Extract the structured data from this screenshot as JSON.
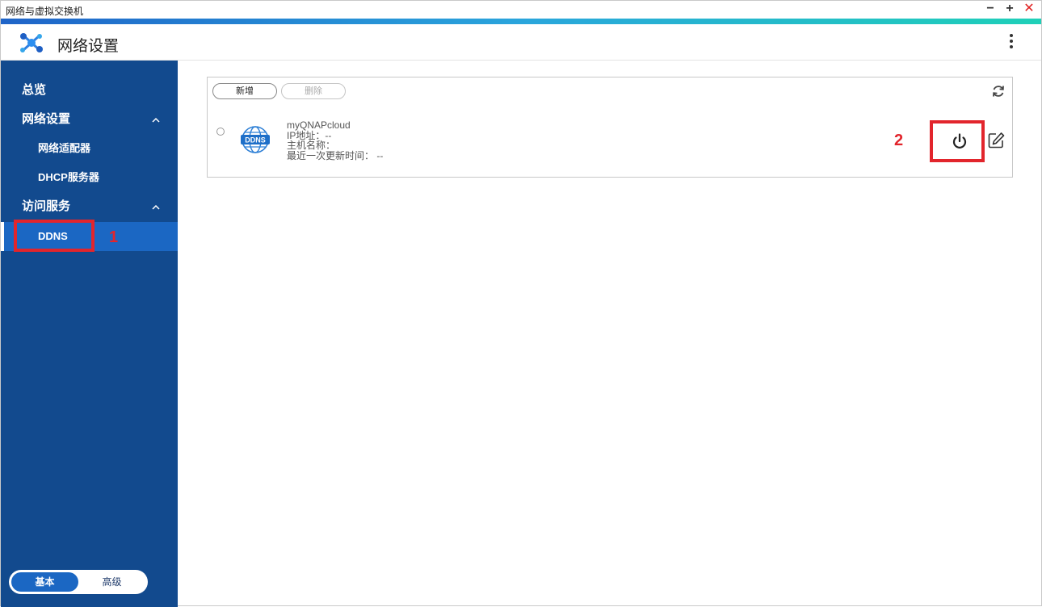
{
  "window": {
    "title": "网络与虚拟交换机",
    "controls": {
      "minimize": "−",
      "maximize": "+",
      "close": "✕"
    }
  },
  "header": {
    "app_title": "网络设置",
    "app_icon": "network-settings-icon",
    "menu_icon": "kebab-menu-icon"
  },
  "sidebar": {
    "overview": "总览",
    "network_settings": "网络设置",
    "network_adapter": "网络适配器",
    "dhcp_server": "DHCP服务器",
    "access_services": "访问服务",
    "ddns": "DDNS",
    "mode": {
      "basic": "基本",
      "advanced": "高级",
      "selected": "基本"
    }
  },
  "toolbar": {
    "add_label": "新增",
    "delete_label": "删除",
    "refresh_icon": "refresh-icon"
  },
  "ddns_entry": {
    "logo_text": "DDNS",
    "service": "myQNAPcloud",
    "ip_line": "IP地址：--",
    "host_line": "主机名称：",
    "update_line": "最近一次更新时间： --"
  },
  "annotations": {
    "step1": "1",
    "step2": "2"
  },
  "colors": {
    "sidebar_bg": "#124a8e",
    "sidebar_active": "#1b67c3",
    "annotation_red": "#e2252c",
    "close_red": "#e02020"
  }
}
